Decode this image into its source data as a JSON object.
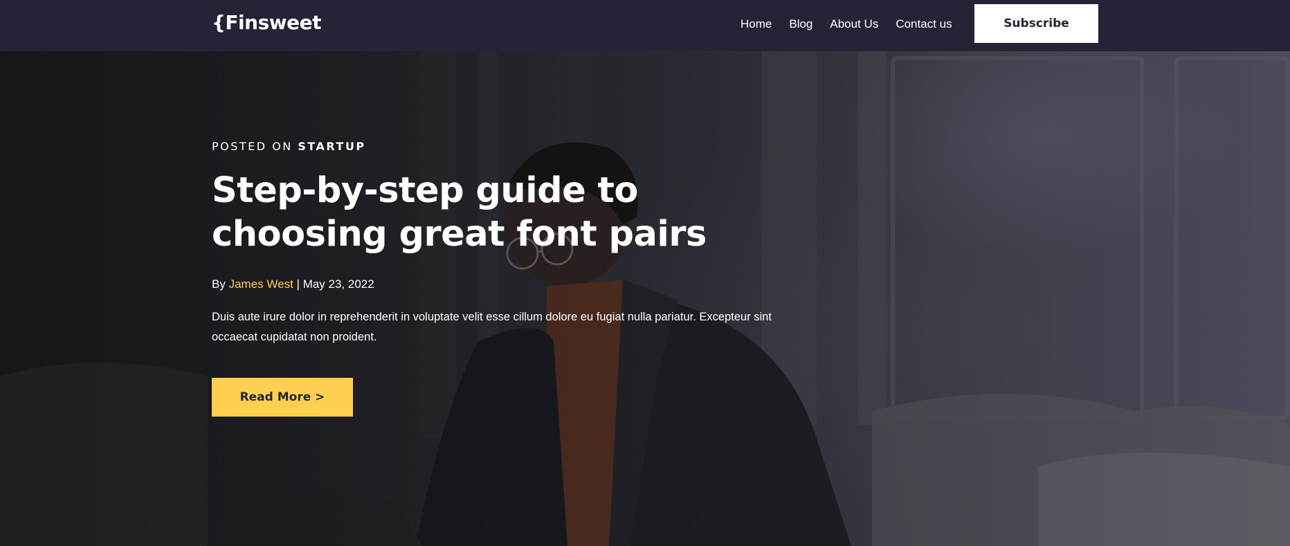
{
  "brand": {
    "logo_text": "{Finsweet"
  },
  "nav": {
    "links": [
      {
        "label": "Home"
      },
      {
        "label": "Blog"
      },
      {
        "label": "About Us"
      },
      {
        "label": "Contact us"
      }
    ],
    "subscribe_label": "Subscribe"
  },
  "hero": {
    "posted_prefix": "POSTED ON",
    "category": "STARTUP",
    "title": "Step-by-step guide to choosing great font pairs",
    "byline_prefix": "By",
    "author": "James West",
    "separator": "|",
    "date": "May 23, 2022",
    "excerpt": "Duis aute irure dolor in reprehenderit in voluptate velit esse cillum dolore eu fugiat nulla pariatur. Excepteur sint occaecat cupidatat non proident.",
    "read_more_label": "Read More >"
  },
  "colors": {
    "nav_bg": "#232536",
    "accent": "#FFD050",
    "text": "#FFFFFF",
    "button_text": "#232536"
  }
}
